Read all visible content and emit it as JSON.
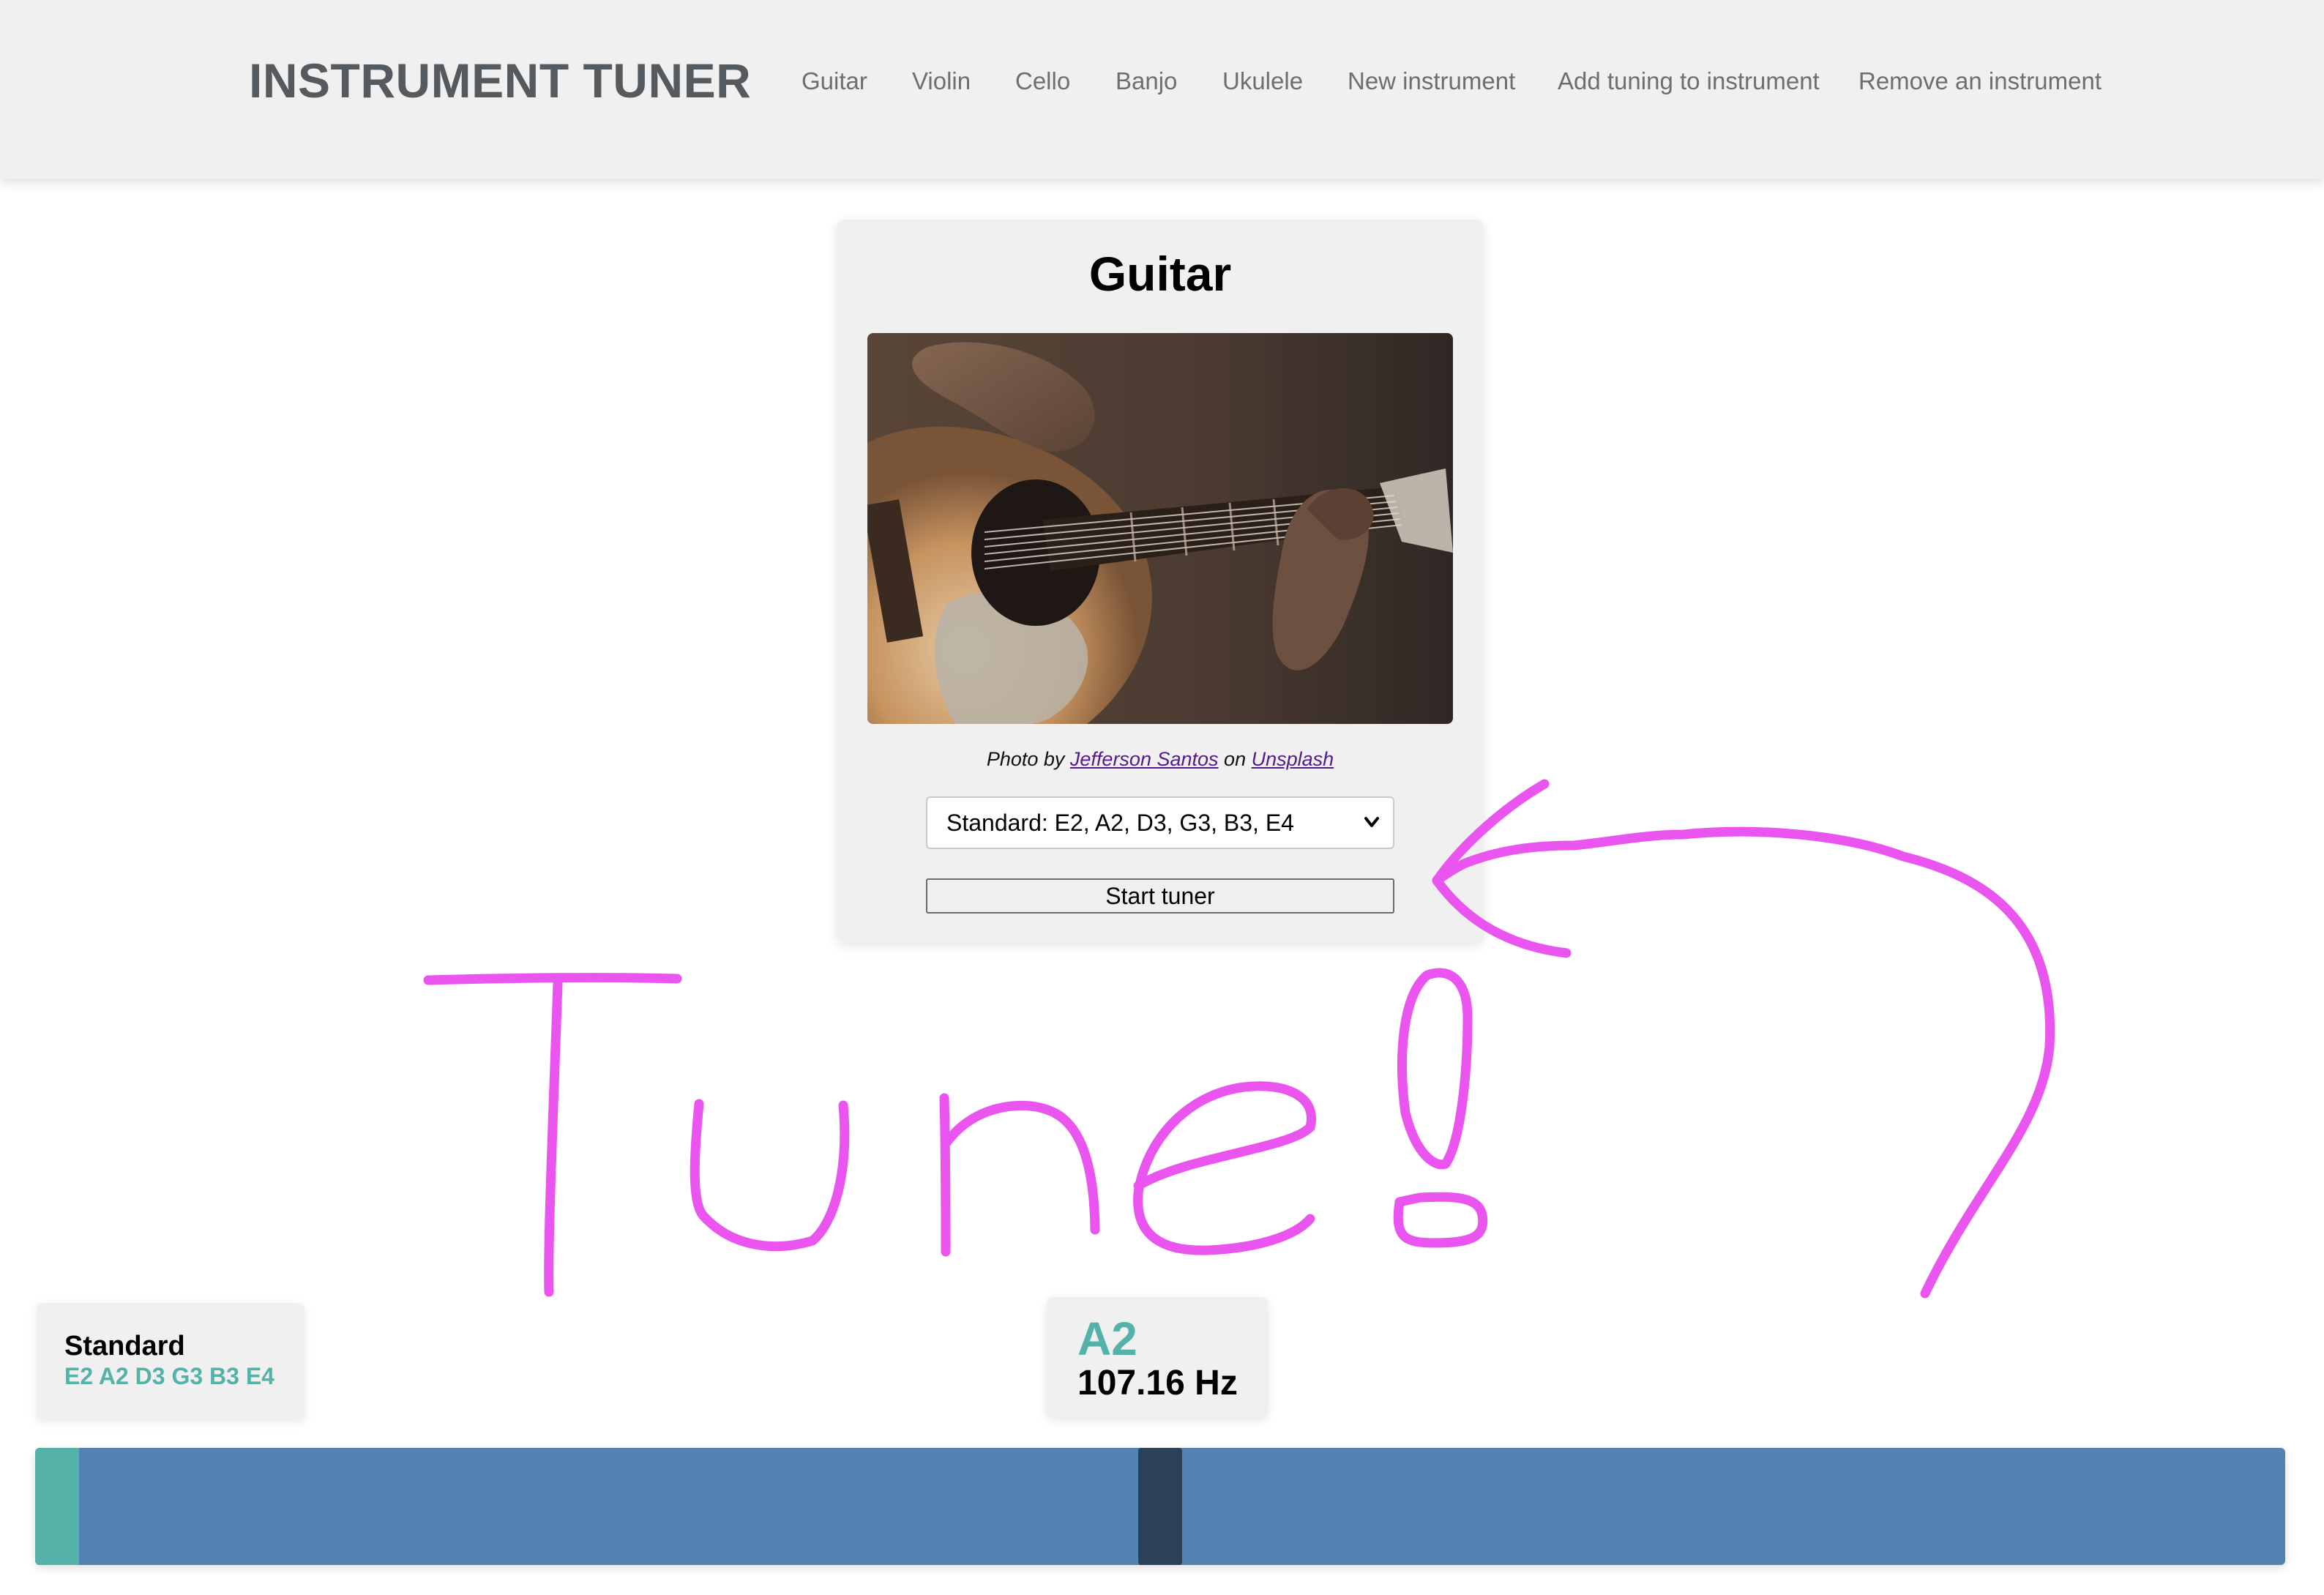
{
  "header": {
    "brand": "INSTRUMENT TUNER",
    "nav": [
      "Guitar",
      "Violin",
      "Cello",
      "Banjo",
      "Ukulele",
      "New instrument",
      "Add tuning to instrument",
      "Remove an instrument"
    ]
  },
  "card": {
    "title": "Guitar",
    "photo_icon": "guitar-photo",
    "credit": {
      "prefix": "Photo by",
      "author": "Jefferson Santos",
      "middle": "on",
      "site": "Unsplash"
    },
    "tuning_select": "Standard: E2, A2, D3, G3, B3, E4",
    "start_label": "Start tuner"
  },
  "annotation": {
    "text": "Tune!",
    "color": "#ea55f0"
  },
  "tuning_info": {
    "name": "Standard",
    "notes": "E2 A2 D3 G3 B3 E4"
  },
  "detected": {
    "note": "A2",
    "frequency": "107.16 Hz"
  },
  "meter": {
    "needle_fraction": 0.5,
    "bar_color": "#5482b2",
    "target_color": "#55b2a8",
    "needle_color": "#2b4158"
  }
}
